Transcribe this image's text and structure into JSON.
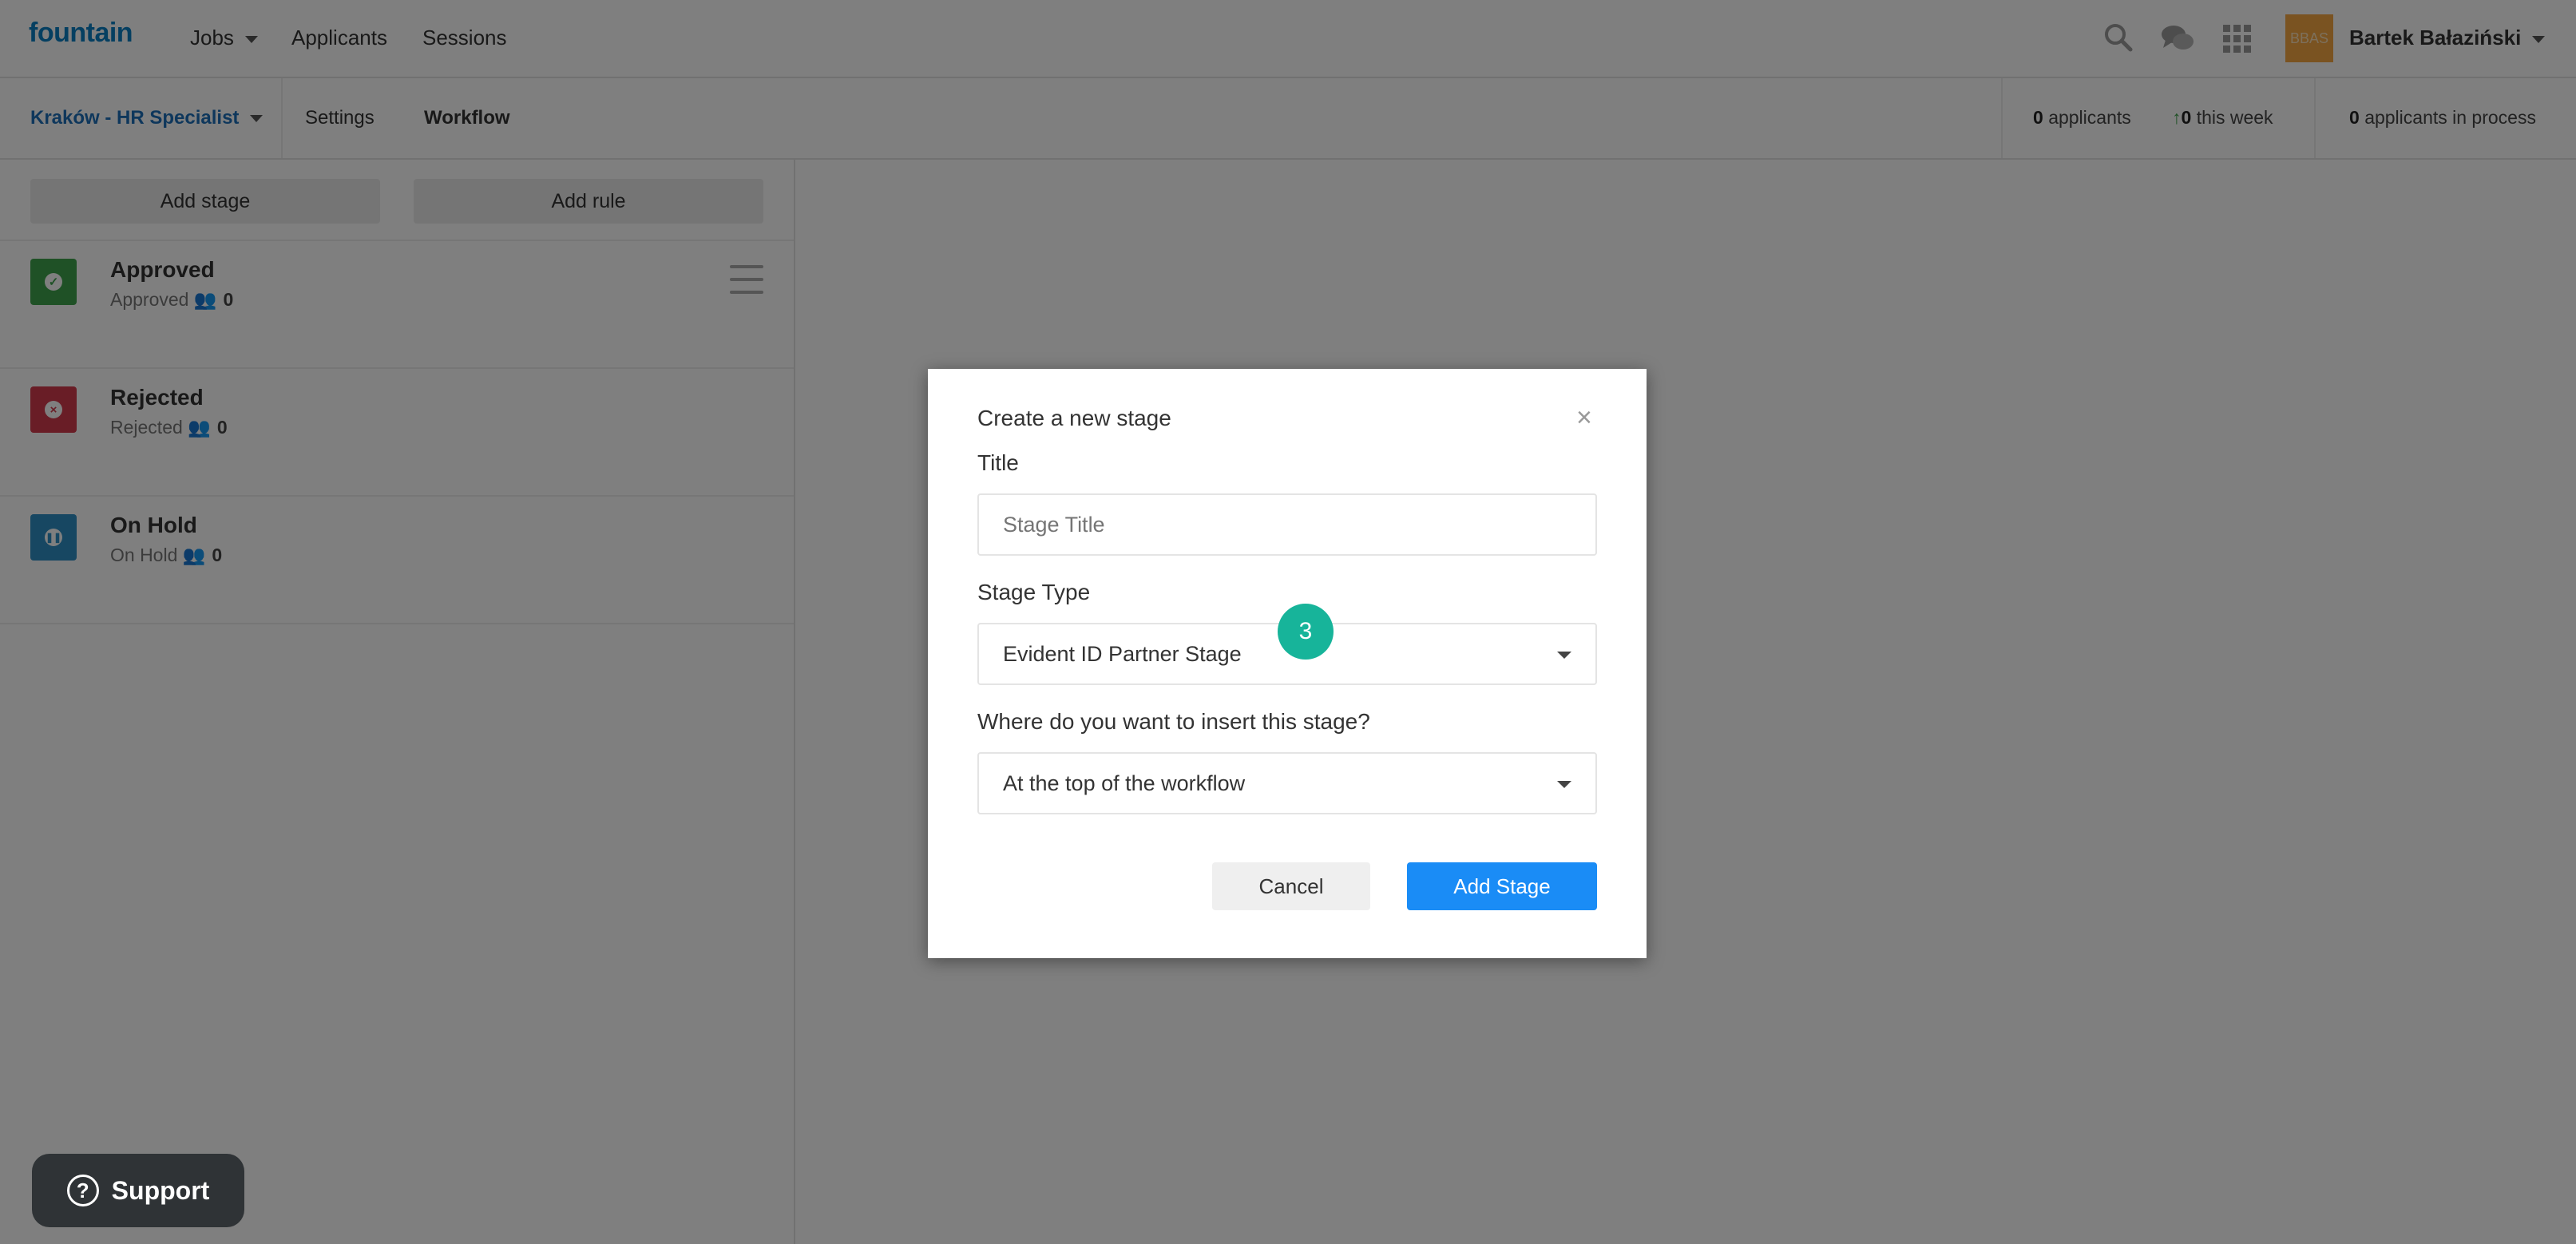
{
  "topnav": {
    "logo": "fountain",
    "items": [
      "Jobs",
      "Applicants",
      "Sessions"
    ],
    "icons": [
      "search-icon",
      "chat-icon",
      "apps-grid-icon"
    ],
    "avatar_text": "BBAS",
    "username": "Bartek Bałaziński"
  },
  "subnav": {
    "job": "Kraków - HR Specialist",
    "settings": "Settings",
    "workflow": "Workflow",
    "applicants_count": "0",
    "applicants_label": "applicants",
    "week_count": "0",
    "week_label": "this week",
    "in_process_count": "0",
    "in_process_label": "applicants in process"
  },
  "panel": {
    "add_stage": "Add stage",
    "add_rule": "Add rule",
    "stages": [
      {
        "title": "Approved",
        "sub": "Approved",
        "count": "0",
        "color": "#3fa34d"
      },
      {
        "title": "Rejected",
        "sub": "Rejected",
        "count": "0",
        "color": "#d23a4d"
      },
      {
        "title": "On Hold",
        "sub": "On Hold",
        "count": "0",
        "color": "#2f8fc4"
      }
    ]
  },
  "support": {
    "label": "Support"
  },
  "modal": {
    "title": "Create a new stage",
    "close": "×",
    "title_label": "Title",
    "title_placeholder": "Stage Title",
    "type_label": "Stage Type",
    "type_value": "Evident ID Partner Stage",
    "insert_label": "Where do you want to insert this stage?",
    "insert_value": "At the top of the workflow",
    "cancel": "Cancel",
    "add": "Add Stage"
  },
  "step_badge": "3",
  "colors": {
    "brand": "#0b7ec2",
    "primary_button": "#1a8cf6",
    "step": "#17b49a"
  }
}
